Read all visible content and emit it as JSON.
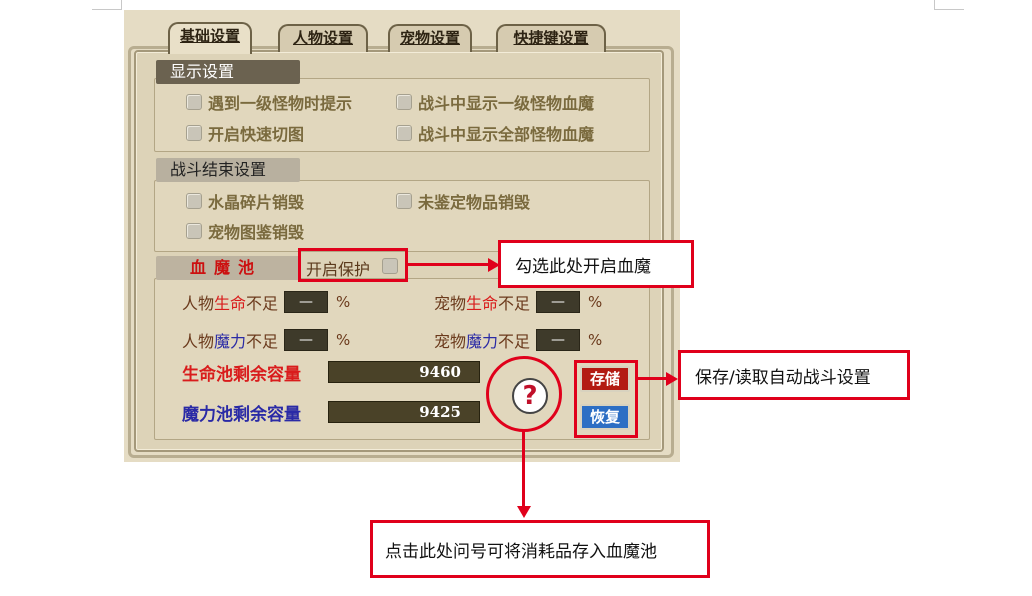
{
  "tabs": [
    {
      "label": "基础设置",
      "active": true
    },
    {
      "label": "人物设置",
      "active": false
    },
    {
      "label": "宠物设置",
      "active": false
    },
    {
      "label": "快捷键设置",
      "active": false
    }
  ],
  "display_settings": {
    "header": "显示设置",
    "options": [
      "遇到一级怪物时提示",
      "战斗中显示一级怪物血魔",
      "开启快速切图",
      "战斗中显示全部怪物血魔"
    ]
  },
  "battle_end_settings": {
    "header": "战斗结束设置",
    "options": [
      "水晶碎片销毁",
      "未鉴定物品销毁",
      "宠物图鉴销毁"
    ]
  },
  "pool": {
    "header": "血魔池",
    "protect_label": "开启保护",
    "char_hp": {
      "prefix": "人物",
      "highlight": "生命",
      "suffix": "不足",
      "value": "—",
      "unit": "%"
    },
    "pet_hp": {
      "prefix": "宠物",
      "highlight": "生命",
      "suffix": "不足",
      "value": "—",
      "unit": "%"
    },
    "char_mp": {
      "prefix": "人物",
      "highlight": "魔力",
      "suffix": "不足",
      "value": "—",
      "unit": "%"
    },
    "pet_mp": {
      "prefix": "宠物",
      "highlight": "魔力",
      "suffix": "不足",
      "value": "—",
      "unit": "%"
    },
    "hp_pool_label": "生命池剩余容量",
    "hp_pool_value": "9460",
    "mp_pool_label": "魔力池剩余容量",
    "mp_pool_value": "9425",
    "help_glyph": "?",
    "save_label": "存储",
    "restore_label": "恢复"
  },
  "annotations": {
    "protect_note": "勾选此处开启血魔",
    "save_note": "保存/读取自动战斗设置",
    "help_note": "点击此处问号可将消耗品存入血魔池"
  },
  "colors": {
    "annotation_red": "#e0001b",
    "hp_red": "#d91c1c",
    "mp_blue": "#2a2aa6",
    "save_button": "#b31a12",
    "restore_button": "#2c6ec4"
  }
}
